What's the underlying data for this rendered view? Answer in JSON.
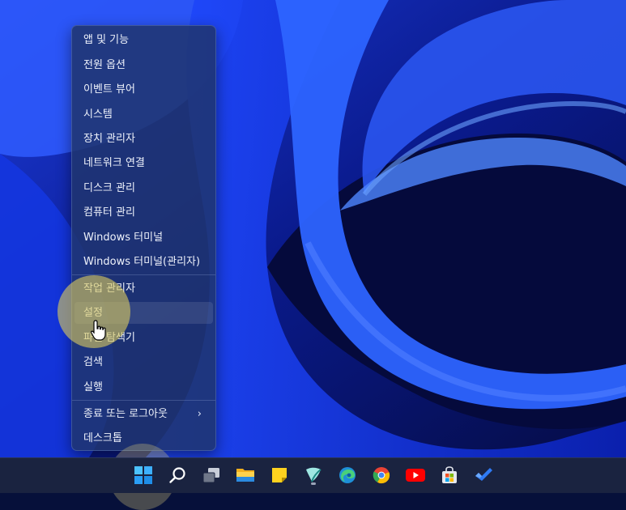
{
  "context_menu": {
    "items": [
      {
        "label": "앱 및 기능"
      },
      {
        "label": "전원 옵션"
      },
      {
        "label": "이벤트 뷰어"
      },
      {
        "label": "시스템"
      },
      {
        "label": "장치 관리자"
      },
      {
        "label": "네트워크 연결"
      },
      {
        "label": "디스크 관리"
      },
      {
        "label": "컴퓨터 관리"
      },
      {
        "label": "Windows 터미널"
      },
      {
        "label": "Windows 터미널(관리자)"
      },
      {
        "label": "작업 관리자"
      },
      {
        "label": "설정"
      },
      {
        "label": "파일 탐색기"
      },
      {
        "label": "검색"
      },
      {
        "label": "실행"
      },
      {
        "label": "종료 또는 로그아웃",
        "submenu_indicator": "›"
      },
      {
        "label": "데스크톱"
      }
    ],
    "hovered_item": "설정"
  },
  "taskbar": {
    "icons": [
      {
        "name": "start-icon"
      },
      {
        "name": "search-icon"
      },
      {
        "name": "task-view-icon"
      },
      {
        "name": "file-explorer-icon"
      },
      {
        "name": "sticky-notes-icon"
      },
      {
        "name": "app-icon",
        "running": true
      },
      {
        "name": "edge-icon"
      },
      {
        "name": "chrome-icon"
      },
      {
        "name": "youtube-icon"
      },
      {
        "name": "microsoft-store-icon"
      },
      {
        "name": "todo-icon"
      }
    ]
  },
  "colors": {
    "accent_blue": "#1a4bff",
    "menu_bg": "#20346e",
    "highlight": "#d7c85f"
  }
}
